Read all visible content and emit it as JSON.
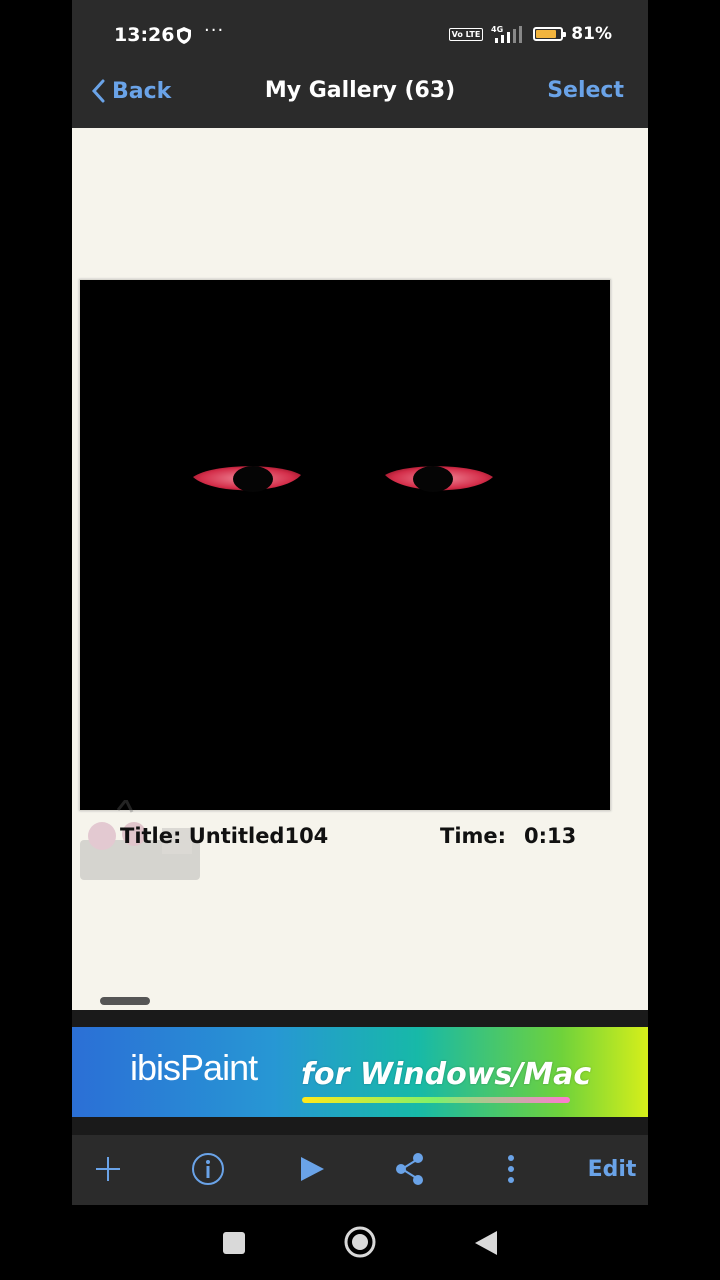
{
  "status_bar": {
    "time": "13:26",
    "shield_icon": "shield-icon",
    "more": "···",
    "network": "4G",
    "volte": "Vo LTE",
    "battery_level": 0.81,
    "battery_text": "81%"
  },
  "nav": {
    "back_label": "Back",
    "title": "My Gallery (63)",
    "select_label": "Select"
  },
  "gallery": {
    "artwork_bg": "#000000",
    "eye_color": "#e0374f",
    "title_text": "Title: Untitled104",
    "time_label": "Time:",
    "time_value": "0:13"
  },
  "banner": {
    "logo_ibis": "ibis",
    "logo_paint": "Paint",
    "tagline": "for Windows/Mac"
  },
  "toolbar": {
    "add_icon": "plus-icon",
    "info_icon": "info-icon",
    "play_icon": "play-icon",
    "share_icon": "share-icon",
    "more_icon": "more-vertical-icon",
    "edit_label": "Edit",
    "accent": "#6aa3e8"
  },
  "system_nav": {
    "recents_icon": "square-icon",
    "home_icon": "circle-icon",
    "back_icon": "triangle-back-icon"
  }
}
